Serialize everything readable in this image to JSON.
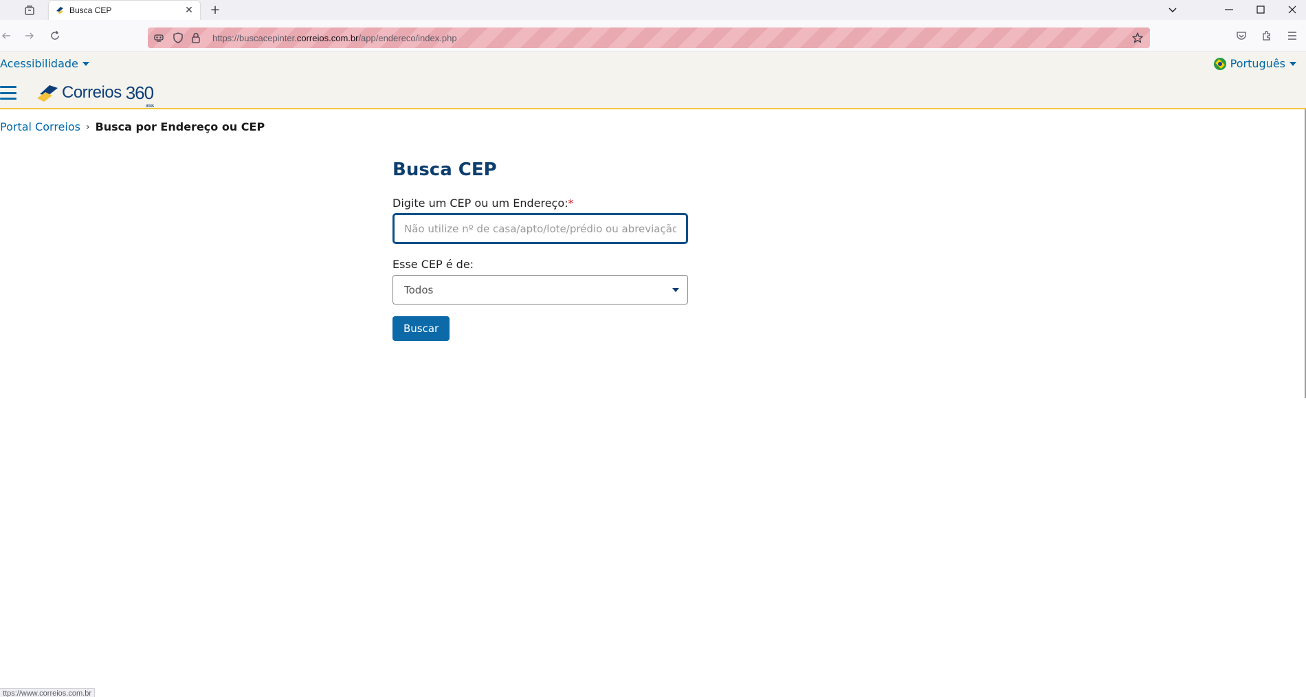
{
  "browser": {
    "tab_title": "Busca CEP",
    "url_prefix": "https://buscacepinter.",
    "url_host": "correios.com.br",
    "url_path": "/app/endereco/index.php",
    "status_text": "ttps://www.correios.com.br"
  },
  "site": {
    "accessibility_label": "Acessibilidade",
    "language_label": "Português",
    "logo_text": "Correios",
    "logo_number": "360",
    "logo_anos": "anos"
  },
  "breadcrumb": {
    "home": "Portal Correios",
    "separator": "›",
    "current": "Busca por Endereço ou CEP"
  },
  "form": {
    "title": "Busca CEP",
    "cep_label": "Digite um CEP ou um Endereço:",
    "required_mark": "*",
    "cep_placeholder": "Não utilize nº de casa/apto/lote/prédio ou abreviação.",
    "cep_value": "",
    "type_label": "Esse CEP é de:",
    "type_selected": "Todos",
    "search_button": "Buscar"
  },
  "colors": {
    "brand_blue": "#0068a8",
    "title_blue": "#0d3e6e",
    "header_yellow": "#f4c23b"
  }
}
